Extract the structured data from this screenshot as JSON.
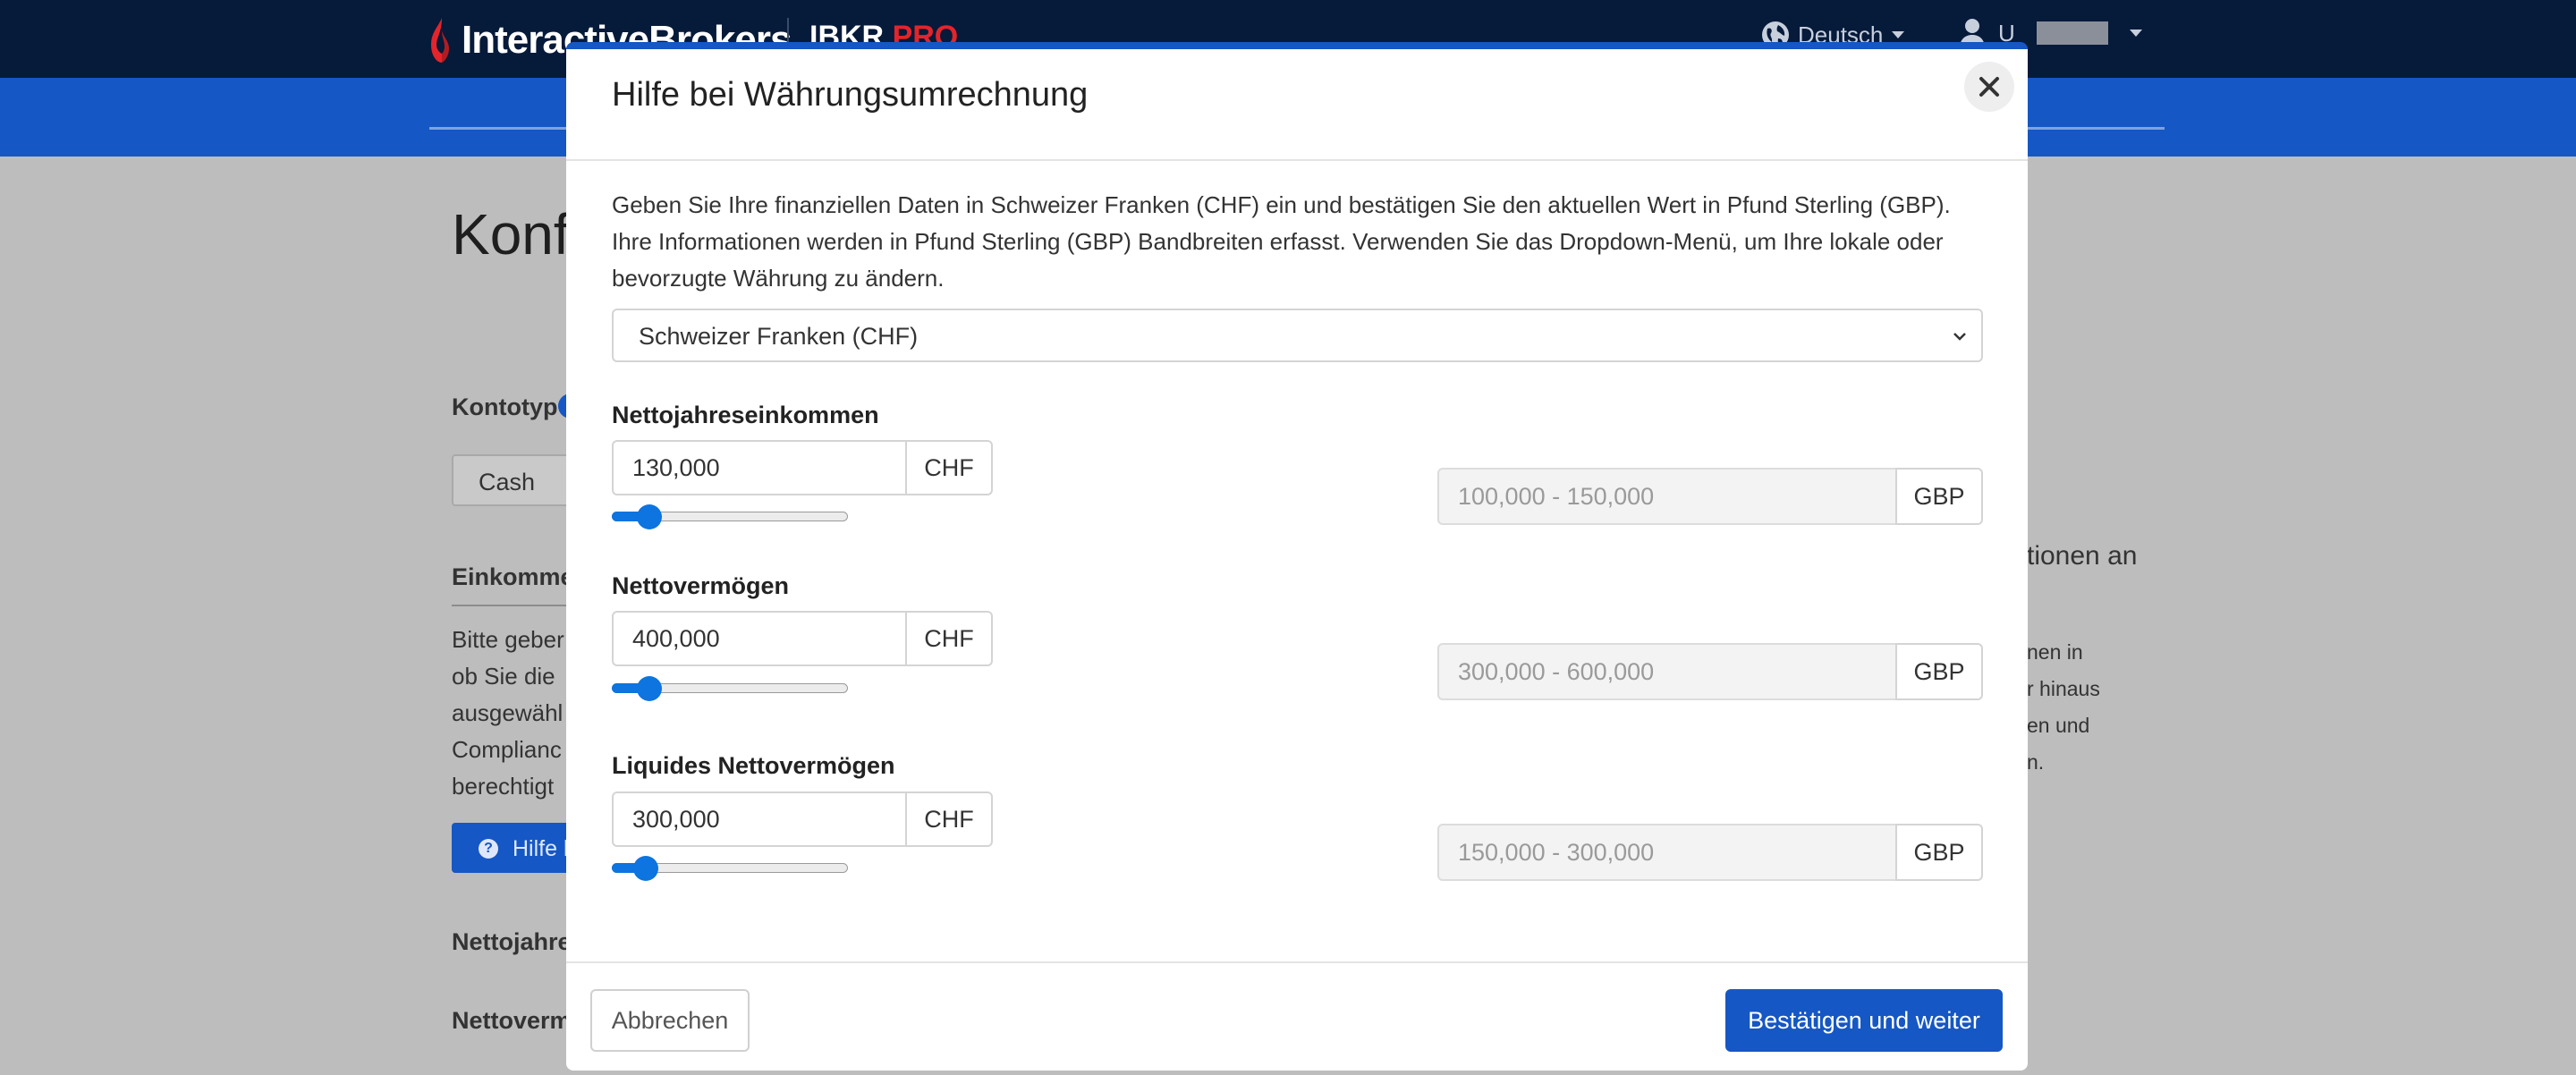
{
  "header": {
    "logo_text": "InteractiveBrokers",
    "product_prefix": "IBKR ",
    "product_suffix": "PRO",
    "language": "Deutsch",
    "user_initial": "U"
  },
  "background": {
    "page_title": "Konf",
    "account_type_label": "Kontotyp",
    "account_type_value": "Cash",
    "income_section": "Einkomme",
    "para_lines": [
      "Bitte geber",
      "ob Sie die",
      "ausgewähl",
      "Complianc",
      "berechtigt"
    ],
    "help_button": "Hilfe b",
    "net_income_label": "Nettojahre",
    "net_worth_label": "Nettoverm",
    "right_heading": "tionen an",
    "right_lines": [
      "nen in",
      "r hinaus",
      "en und",
      "n."
    ]
  },
  "modal": {
    "title": "Hilfe bei Währungsumrechnung",
    "intro": "Geben Sie Ihre finanziellen Daten in Schweizer Franken (CHF) ein und bestätigen Sie den aktuellen Wert in Pfund Sterling (GBP). Ihre Informationen werden in Pfund Sterling (GBP) Bandbreiten erfasst. Verwenden Sie das Dropdown-Menü, um Ihre lokale oder bevorzugte Währung zu ändern.",
    "currency_select": "Schweizer Franken (CHF)",
    "fields": [
      {
        "label": "Nettojahreseinkommen",
        "value": "130,000",
        "unit": "CHF",
        "slider_fraction": 0.12,
        "gbp_range": "100,000 - 150,000",
        "gbp_unit": "GBP"
      },
      {
        "label": "Nettovermögen",
        "value": "400,000",
        "unit": "CHF",
        "slider_fraction": 0.12,
        "gbp_range": "300,000 - 600,000",
        "gbp_unit": "GBP"
      },
      {
        "label": "Liquides Nettovermögen",
        "value": "300,000",
        "unit": "CHF",
        "slider_fraction": 0.1,
        "gbp_range": "150,000 - 300,000",
        "gbp_unit": "GBP"
      }
    ],
    "cancel_label": "Abbrechen",
    "confirm_label": "Bestätigen und weiter"
  },
  "colors": {
    "brand_blue": "#1557c4",
    "nav_dark": "#061a3a",
    "slider_blue": "#0d74e0",
    "logo_red": "#e3242b"
  }
}
